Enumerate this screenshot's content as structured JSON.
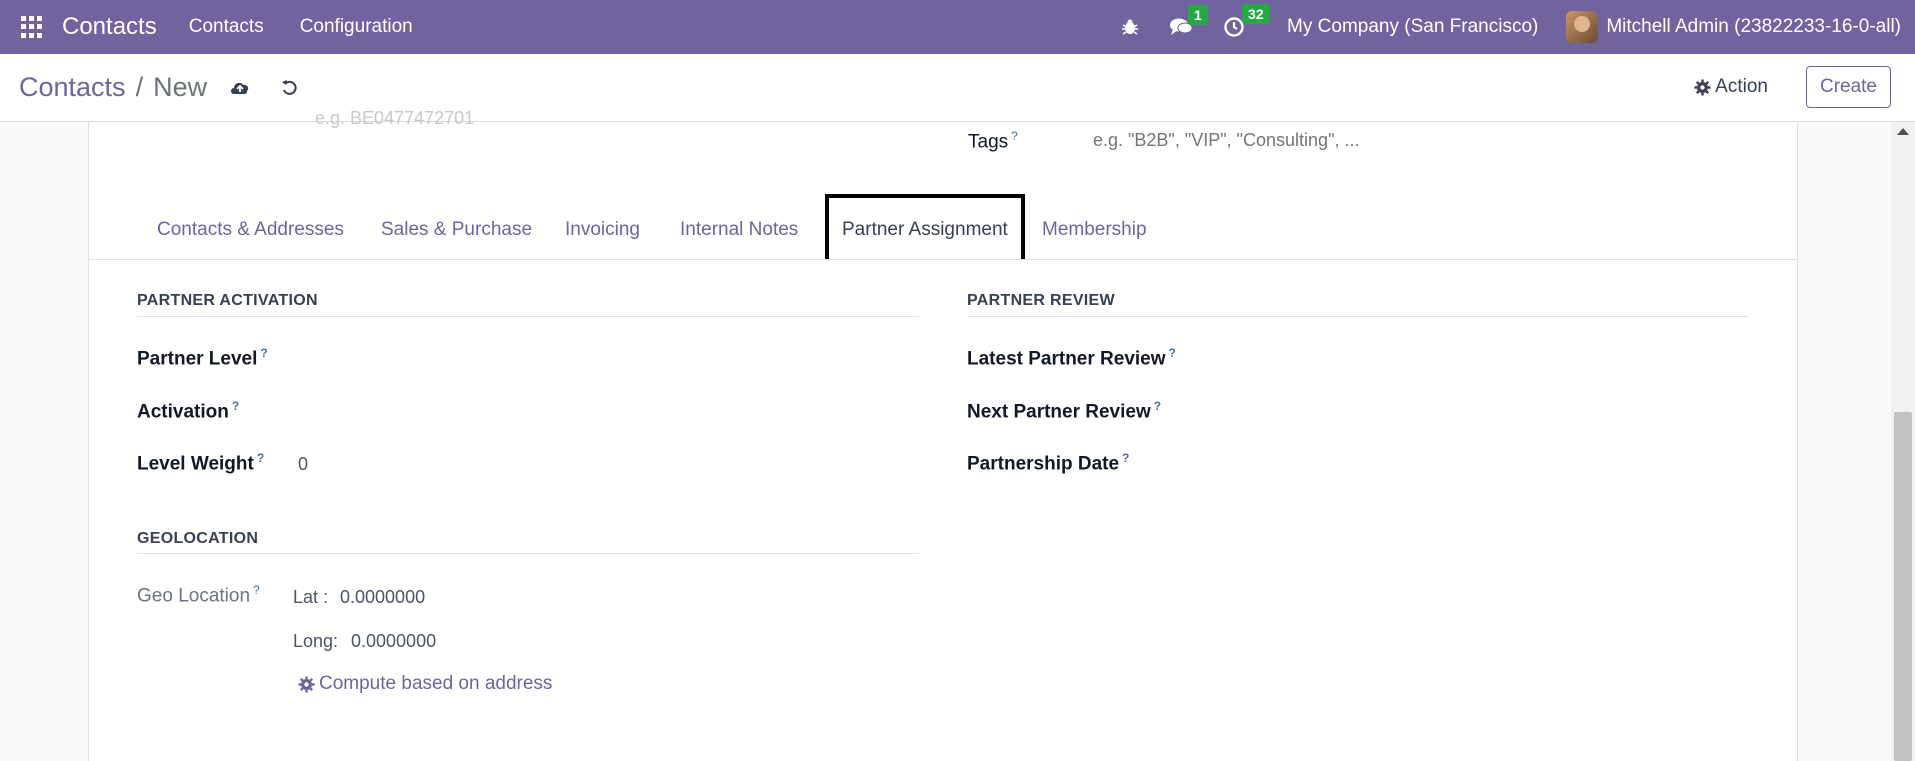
{
  "navbar": {
    "brand": "Contacts",
    "menu": [
      "Contacts",
      "Configuration"
    ],
    "messages_count": "1",
    "activities_count": "32",
    "company": "My Company (San Francisco)",
    "user": "Mitchell Admin (23822233-16-0-all)"
  },
  "control_panel": {
    "breadcrumb_parent": "Contacts",
    "breadcrumb_sep": "/",
    "breadcrumb_current": "New",
    "action_label": "Action",
    "create_label": "Create"
  },
  "form": {
    "top_cut_text": "e.g. BE0477472701",
    "tags_label": "Tags",
    "tags_placeholder": "e.g. \"B2B\", \"VIP\", \"Consulting\", ...",
    "tabs": [
      "Contacts & Addresses",
      "Sales & Purchase",
      "Invoicing",
      "Internal Notes",
      "Partner Assignment",
      "Membership"
    ],
    "active_tab": "Partner Assignment",
    "partner_activation": {
      "title": "PARTNER ACTIVATION",
      "partner_level": "Partner Level",
      "activation": "Activation",
      "level_weight": "Level Weight",
      "level_weight_value": "0"
    },
    "partner_review": {
      "title": "PARTNER REVIEW",
      "latest_review": "Latest Partner Review",
      "next_review": "Next Partner Review",
      "partnership_date": "Partnership Date"
    },
    "geolocation": {
      "title": "GEOLOCATION",
      "geo_location": "Geo Location",
      "lat_label": "Lat :",
      "lat_value": "0.0000000",
      "long_label": "Long:",
      "long_value": "0.0000000",
      "compute_label": "Compute based on address"
    },
    "help_mark": "?"
  },
  "colors": {
    "brand": "#71639e",
    "badge": "#28a745"
  }
}
